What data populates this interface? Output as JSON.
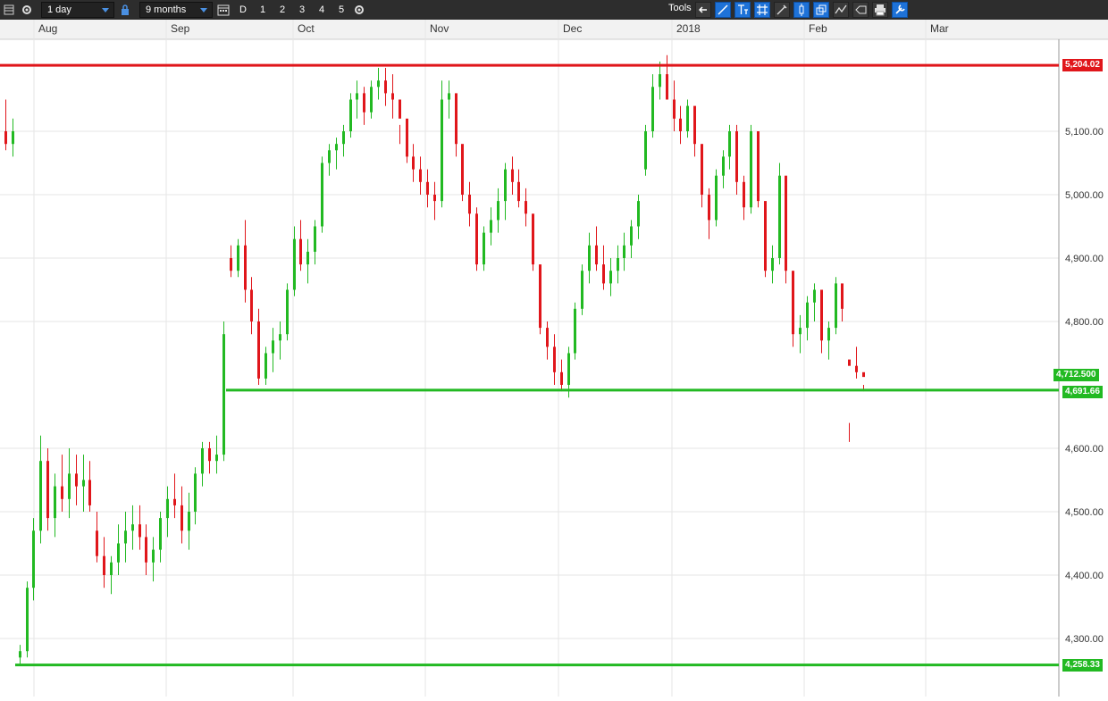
{
  "toolbar": {
    "interval": "1 day",
    "range": "9 months",
    "period_buttons": [
      "D",
      "1",
      "2",
      "3",
      "4",
      "5"
    ],
    "tools_label": "Tools",
    "icons": [
      "table-icon",
      "gear-icon",
      "lock-icon",
      "calendar-icon",
      "settings-gear-icon",
      "back-arrow-icon",
      "trend-line-icon",
      "text-tool-icon",
      "grid-icon",
      "draw-tool-icon",
      "candle-tool-icon",
      "layers-icon",
      "indicator-icon",
      "label-tag-icon",
      "print-icon",
      "wrench-icon"
    ]
  },
  "colors": {
    "up": "#22b922",
    "down": "#e0161b",
    "resistance": "#e0161b",
    "support": "#22b922",
    "grid": "#e6e6e6",
    "toolbar_bg": "#2d2d2d",
    "accent": "#1e72d8"
  },
  "chart_data": {
    "type": "candlestick",
    "x_labels": [
      "Aug",
      "Sep",
      "Oct",
      "Nov",
      "Dec",
      "2018",
      "Feb",
      "Mar"
    ],
    "y_ticks": [
      "4,300.00",
      "4,400.00",
      "4,500.00",
      "4,600.00",
      "4,800.00",
      "4,900.00",
      "5,000.00",
      "5,100.00"
    ],
    "ylim": [
      4250,
      5220
    ],
    "price_labels": {
      "resistance": "5,204.02",
      "current": "4,712.500",
      "support": "4,691.66",
      "low_support": "4,258.33"
    },
    "levels": {
      "resistance": 5204.02,
      "support": 4691.66,
      "low_support": 4258.33,
      "current": 4712.5
    },
    "candles": [
      [
        5100,
        5150,
        5070,
        5080
      ],
      [
        5080,
        5120,
        5060,
        5100
      ],
      [
        4270,
        4290,
        4260,
        4280
      ],
      [
        4280,
        4390,
        4270,
        4380
      ],
      [
        4380,
        4490,
        4360,
        4470
      ],
      [
        4470,
        4620,
        4450,
        4580
      ],
      [
        4580,
        4600,
        4470,
        4490
      ],
      [
        4490,
        4560,
        4460,
        4540
      ],
      [
        4540,
        4590,
        4500,
        4520
      ],
      [
        4520,
        4600,
        4490,
        4560
      ],
      [
        4560,
        4590,
        4510,
        4540
      ],
      [
        4540,
        4590,
        4500,
        4550
      ],
      [
        4550,
        4580,
        4500,
        4510
      ],
      [
        4470,
        4500,
        4420,
        4430
      ],
      [
        4430,
        4460,
        4380,
        4400
      ],
      [
        4400,
        4430,
        4370,
        4420
      ],
      [
        4420,
        4480,
        4400,
        4450
      ],
      [
        4450,
        4500,
        4420,
        4470
      ],
      [
        4470,
        4510,
        4440,
        4480
      ],
      [
        4480,
        4510,
        4440,
        4460
      ],
      [
        4460,
        4480,
        4400,
        4420
      ],
      [
        4420,
        4460,
        4390,
        4440
      ],
      [
        4440,
        4500,
        4420,
        4490
      ],
      [
        4490,
        4540,
        4460,
        4520
      ],
      [
        4520,
        4560,
        4490,
        4510
      ],
      [
        4510,
        4540,
        4450,
        4470
      ],
      [
        4470,
        4530,
        4440,
        4500
      ],
      [
        4500,
        4570,
        4480,
        4560
      ],
      [
        4560,
        4610,
        4540,
        4600
      ],
      [
        4600,
        4610,
        4560,
        4580
      ],
      [
        4580,
        4620,
        4560,
        4590
      ],
      [
        4590,
        4800,
        4580,
        4780
      ],
      [
        4900,
        4920,
        4870,
        4880
      ],
      [
        4880,
        4930,
        4870,
        4920
      ],
      [
        4920,
        4960,
        4830,
        4850
      ],
      [
        4850,
        4870,
        4780,
        4800
      ],
      [
        4800,
        4820,
        4700,
        4710
      ],
      [
        4710,
        4760,
        4700,
        4750
      ],
      [
        4750,
        4790,
        4720,
        4770
      ],
      [
        4770,
        4800,
        4740,
        4780
      ],
      [
        4780,
        4860,
        4770,
        4850
      ],
      [
        4850,
        4950,
        4840,
        4930
      ],
      [
        4930,
        4960,
        4880,
        4890
      ],
      [
        4890,
        4930,
        4860,
        4910
      ],
      [
        4910,
        4960,
        4890,
        4950
      ],
      [
        4950,
        5060,
        4940,
        5050
      ],
      [
        5050,
        5080,
        5030,
        5070
      ],
      [
        5070,
        5090,
        5040,
        5080
      ],
      [
        5080,
        5110,
        5060,
        5100
      ],
      [
        5100,
        5160,
        5090,
        5150
      ],
      [
        5150,
        5180,
        5120,
        5160
      ],
      [
        5160,
        5170,
        5110,
        5130
      ],
      [
        5130,
        5180,
        5120,
        5170
      ],
      [
        5170,
        5200,
        5150,
        5180
      ],
      [
        5180,
        5200,
        5140,
        5160
      ],
      [
        5160,
        5190,
        5120,
        5150
      ],
      [
        5150,
        5110,
        5080,
        5120
      ],
      [
        5120,
        5080,
        5050,
        5060
      ],
      [
        5060,
        5080,
        5020,
        5040
      ],
      [
        5040,
        5060,
        5000,
        5020
      ],
      [
        5020,
        5040,
        4980,
        5000
      ],
      [
        5000,
        5020,
        4960,
        4990
      ],
      [
        4990,
        5180,
        4980,
        5150
      ],
      [
        5150,
        5180,
        5120,
        5160
      ],
      [
        5160,
        5140,
        5060,
        5080
      ],
      [
        5080,
        5060,
        4990,
        5000
      ],
      [
        5000,
        5020,
        4950,
        4970
      ],
      [
        4970,
        4980,
        4880,
        4890
      ],
      [
        4890,
        4950,
        4880,
        4940
      ],
      [
        4940,
        4980,
        4920,
        4960
      ],
      [
        4960,
        5010,
        4940,
        4990
      ],
      [
        4990,
        5050,
        4960,
        5040
      ],
      [
        5040,
        5060,
        5000,
        5020
      ],
      [
        5020,
        5040,
        4980,
        4990
      ],
      [
        4990,
        5010,
        4950,
        4970
      ],
      [
        4970,
        4930,
        4880,
        4890
      ],
      [
        4890,
        4860,
        4780,
        4790
      ],
      [
        4790,
        4800,
        4740,
        4760
      ],
      [
        4760,
        4780,
        4700,
        4720
      ],
      [
        4720,
        4740,
        4690,
        4700
      ],
      [
        4700,
        4760,
        4680,
        4750
      ],
      [
        4750,
        4830,
        4740,
        4820
      ],
      [
        4820,
        4890,
        4810,
        4880
      ],
      [
        4880,
        4940,
        4860,
        4920
      ],
      [
        4920,
        4950,
        4880,
        4890
      ],
      [
        4890,
        4920,
        4850,
        4860
      ],
      [
        4860,
        4900,
        4840,
        4880
      ],
      [
        4880,
        4920,
        4860,
        4900
      ],
      [
        4900,
        4940,
        4880,
        4920
      ],
      [
        4920,
        4960,
        4900,
        4950
      ],
      [
        4950,
        5000,
        4930,
        4990
      ],
      [
        5040,
        5110,
        5030,
        5100
      ],
      [
        5100,
        5190,
        5090,
        5170
      ],
      [
        5170,
        5210,
        5150,
        5190
      ],
      [
        5190,
        5220,
        5160,
        5150
      ],
      [
        5150,
        5180,
        5100,
        5120
      ],
      [
        5120,
        5140,
        5080,
        5100
      ],
      [
        5100,
        5150,
        5090,
        5140
      ],
      [
        5140,
        5130,
        5060,
        5080
      ],
      [
        5080,
        5060,
        4980,
        5000
      ],
      [
        5000,
        5010,
        4930,
        4960
      ],
      [
        4960,
        5040,
        4950,
        5030
      ],
      [
        5030,
        5070,
        5010,
        5060
      ],
      [
        5060,
        5110,
        5040,
        5100
      ],
      [
        5100,
        5110,
        5000,
        5020
      ],
      [
        5020,
        5030,
        4960,
        4980
      ],
      [
        4980,
        5110,
        4970,
        5100
      ],
      [
        5100,
        5090,
        4980,
        4990
      ],
      [
        4990,
        4960,
        4870,
        4880
      ],
      [
        4880,
        4920,
        4860,
        4900
      ],
      [
        4900,
        5050,
        4890,
        5030
      ],
      [
        5030,
        5010,
        4860,
        4880
      ],
      [
        4880,
        4860,
        4760,
        4780
      ],
      [
        4780,
        4810,
        4750,
        4790
      ],
      [
        4790,
        4840,
        4770,
        4830
      ],
      [
        4830,
        4860,
        4800,
        4850
      ],
      [
        4850,
        4820,
        4750,
        4770
      ],
      [
        4770,
        4800,
        4740,
        4790
      ],
      [
        4790,
        4870,
        4780,
        4860
      ],
      [
        4860,
        4850,
        4800,
        4820
      ],
      [
        4740,
        4640,
        4610,
        4730
      ],
      [
        4730,
        4760,
        4710,
        4720
      ],
      [
        4720,
        4690,
        4700,
        4712.5
      ]
    ]
  }
}
